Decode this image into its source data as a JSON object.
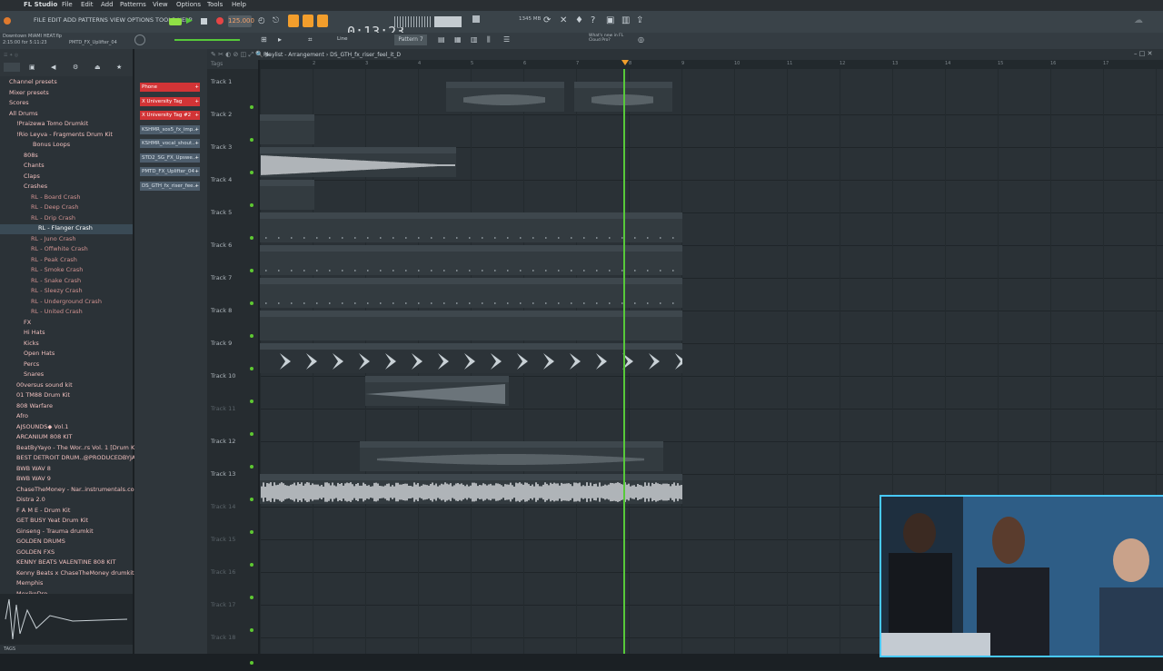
{
  "menubar": {
    "app": "FL Studio",
    "items": [
      "File",
      "Edit",
      "Add",
      "Patterns",
      "View",
      "Options",
      "Tools",
      "Help"
    ]
  },
  "toolbar": {
    "menu": "FILE EDIT ADD PATTERNS VIEW OPTIONS TOOLS HELP",
    "bpm": "125.000",
    "time": "0:13:23",
    "pattern": "Pattern 7",
    "cpu": "1345 MB",
    "project": "Downtown MIAMI HEAT.flp",
    "hint": "2:15:00 for 5:11:23",
    "hint2": "PMTD_FX_Uplifter_04",
    "news": "What's new in FL Cloud Pro?",
    "mode": "Line"
  },
  "playlist": {
    "title": "Playlist - Arrangement › DS_GTH_fx_riser_feel_it_D"
  },
  "browser": {
    "items": [
      {
        "label": "Channel presets",
        "type": "folder"
      },
      {
        "label": "Mixer presets",
        "type": "folder"
      },
      {
        "label": "Scores",
        "type": "folder"
      },
      {
        "label": "All Drums",
        "type": "folder"
      },
      {
        "label": "!Praizewa Tomo Drumkit",
        "type": "folder"
      },
      {
        "label": "!Rio Leyva - Fragments Drum Kit",
        "type": "folder"
      },
      {
        "label": "Bonus Loops",
        "type": "folder"
      },
      {
        "label": "808s",
        "type": "folder"
      },
      {
        "label": "Chants",
        "type": "folder"
      },
      {
        "label": "Claps",
        "type": "folder"
      },
      {
        "label": "Crashes",
        "type": "folder"
      },
      {
        "label": "RL - Board Crash",
        "type": "file"
      },
      {
        "label": "RL - Deep Crash",
        "type": "file"
      },
      {
        "label": "RL - Drip Crash",
        "type": "file"
      },
      {
        "label": "RL - Flanger Crash",
        "type": "sel"
      },
      {
        "label": "RL - Juno Crash",
        "type": "file"
      },
      {
        "label": "RL - Offwhite Crash",
        "type": "file"
      },
      {
        "label": "RL - Peak Crash",
        "type": "file"
      },
      {
        "label": "RL - Smoke Crash",
        "type": "file"
      },
      {
        "label": "RL - Snake Crash",
        "type": "file"
      },
      {
        "label": "RL - Sleezy Crash",
        "type": "file"
      },
      {
        "label": "RL - Underground Crash",
        "type": "file"
      },
      {
        "label": "RL - United Crash",
        "type": "file"
      },
      {
        "label": "FX",
        "type": "folder"
      },
      {
        "label": "Hi Hats",
        "type": "folder"
      },
      {
        "label": "Kicks",
        "type": "folder"
      },
      {
        "label": "Open Hats",
        "type": "folder"
      },
      {
        "label": "Percs",
        "type": "folder"
      },
      {
        "label": "Snares",
        "type": "folder"
      },
      {
        "label": "00versus sound kit",
        "type": "folder"
      },
      {
        "label": "01 TM88 Drum Kit",
        "type": "folder"
      },
      {
        "label": "808 Warfare",
        "type": "folder"
      },
      {
        "label": "Afro",
        "type": "folder"
      },
      {
        "label": "AJSOUNDS◆ Vol.1",
        "type": "folder"
      },
      {
        "label": "ARCANIUM 808 KIT",
        "type": "folder"
      },
      {
        "label": "BeatByYayo - The Wor..rs Vol. 1 [Drum Kit]",
        "type": "folder"
      },
      {
        "label": "BEST DETROIT DRUM..@PRODUCEDBYJAVEN",
        "type": "folder"
      },
      {
        "label": "BWB WAV 8",
        "type": "folder"
      },
      {
        "label": "BWB WAV 9",
        "type": "folder"
      },
      {
        "label": "ChaseTheMoney - Nar..instrumentals.com)",
        "type": "folder"
      },
      {
        "label": "Distra 2.0",
        "type": "folder"
      },
      {
        "label": "F A M E - Drum Kit",
        "type": "folder"
      },
      {
        "label": "GET BUSY Yeat Drum Kit",
        "type": "folder"
      },
      {
        "label": "Ginseng - Trauma drumkit",
        "type": "folder"
      },
      {
        "label": "GOLDEN DRUMS",
        "type": "folder"
      },
      {
        "label": "GOLDEN FXS",
        "type": "folder"
      },
      {
        "label": "KENNY BEATS VALENTINE 808 KIT",
        "type": "folder"
      },
      {
        "label": "Kenny Beats x ChaseTheMoney drumkit",
        "type": "folder"
      },
      {
        "label": "Memphis",
        "type": "folder"
      },
      {
        "label": "MexikoDro",
        "type": "folder"
      }
    ],
    "footer": "TAGS"
  },
  "picker": [
    {
      "label": "Phone",
      "color": "red"
    },
    {
      "label": "X University Tag",
      "color": "red"
    },
    {
      "label": "X University Tag #2",
      "color": "red"
    },
    {
      "label": "KSHMR_sos5_fx_imp..",
      "color": "blue"
    },
    {
      "label": "KSHMR_vocal_shout..",
      "color": "blue"
    },
    {
      "label": "STD2_SG_FX_Upswe..",
      "color": "blue"
    },
    {
      "label": "PMTD_FX_Uplifter_04",
      "color": "blue"
    },
    {
      "label": "DS_GTH_fx_riser_fee..",
      "color": "blue"
    }
  ],
  "tracks": [
    "Track 1",
    "Track 2",
    "Track 3",
    "Track 4",
    "Track 5",
    "Track 6",
    "Track 7",
    "Track 8",
    "Track 9",
    "Track 10",
    "Track 11",
    "Track 12",
    "Track 13",
    "Track 14",
    "Track 15",
    "Track 16",
    "Track 17",
    "Track 18"
  ],
  "ruler": [
    "2",
    "3",
    "4",
    "5",
    "6",
    "7",
    "8",
    "9",
    "10",
    "11",
    "12",
    "13",
    "14",
    "15",
    "16",
    "17"
  ],
  "clips": [
    {
      "name": "X University Tag",
      "text": "5.0dB"
    },
    {
      "name": "X University Tag #2",
      "text": ""
    },
    {
      "name": "Pattern 1",
      "text": ""
    },
    {
      "name": "KSHMR_sos5_fx_impact_main_classic_paradise",
      "text": ""
    },
    {
      "name": "WHISTLE",
      "text": ""
    },
    {
      "name": "CLAPS",
      "text": ""
    },
    {
      "name": "STOMP",
      "text": ""
    },
    {
      "name": "HI HAT",
      "text": ""
    },
    {
      "name": "COW BELL",
      "text": ""
    },
    {
      "name": "STD2_SG_FX_Upsweep_Slow",
      "text": ""
    },
    {
      "name": "PMTD_FX_Uplifter_04",
      "text": ""
    },
    {
      "name": "DS_GTH_fx_riser_feel_it_D",
      "text": ""
    }
  ],
  "colors": {
    "accent": "#57c93a",
    "red": "#d23436",
    "webcam_border": "#48c9ff"
  }
}
